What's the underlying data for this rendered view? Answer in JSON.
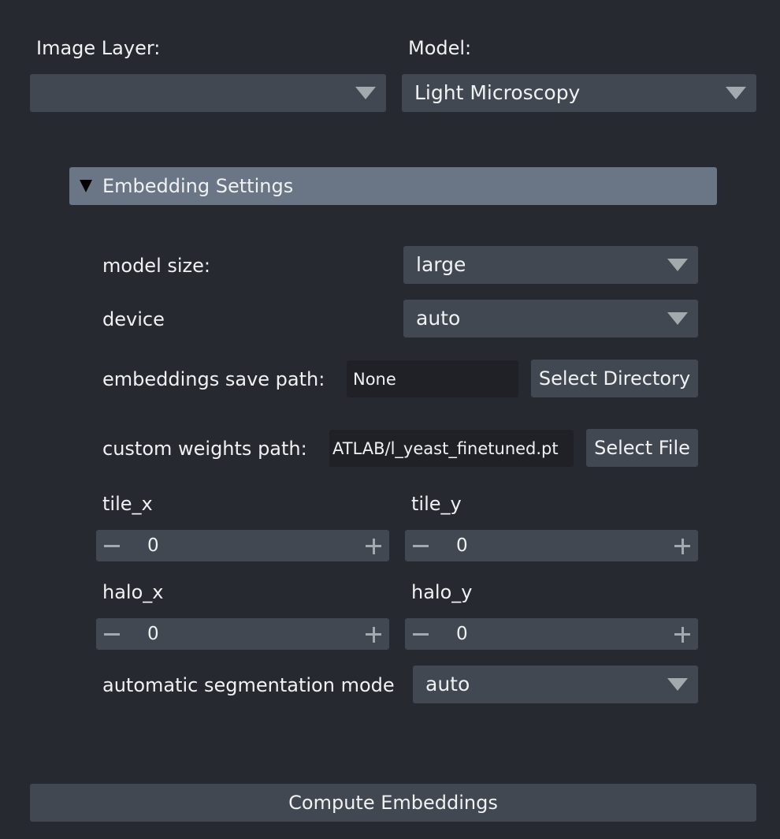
{
  "header": {
    "image_layer_label": "Image Layer:",
    "image_layer_value": "",
    "model_label": "Model:",
    "model_value": "Light Microscopy"
  },
  "embedding_settings": {
    "title": "Embedding Settings",
    "expanded": true,
    "model_size_label": "model size:",
    "model_size_value": "large",
    "device_label": "device",
    "device_value": "auto",
    "save_path_label": "embeddings save path:",
    "save_path_value": "None",
    "select_directory_label": "Select Directory",
    "weights_path_label": "custom weights path:",
    "weights_path_value": "ATLAB/l_yeast_finetuned.pt",
    "select_file_label": "Select File",
    "tile_x_label": "tile_x",
    "tile_x_value": "0",
    "tile_y_label": "tile_y",
    "tile_y_value": "0",
    "halo_x_label": "halo_x",
    "halo_x_value": "0",
    "halo_y_label": "halo_y",
    "halo_y_value": "0",
    "seg_mode_label": "automatic segmentation mode",
    "seg_mode_value": "auto"
  },
  "actions": {
    "compute_label": "Compute Embeddings"
  },
  "icons": {
    "dropdown": "chevron-down-icon",
    "collapse": "triangle-down-icon",
    "decrement": "minus-icon",
    "increment": "plus-icon"
  },
  "colors": {
    "background": "#262930",
    "control": "#414851",
    "field": "#1f2127",
    "section_header": "#6a7685",
    "arrow": "#a4a9ae",
    "text": "#f0f1f2"
  }
}
